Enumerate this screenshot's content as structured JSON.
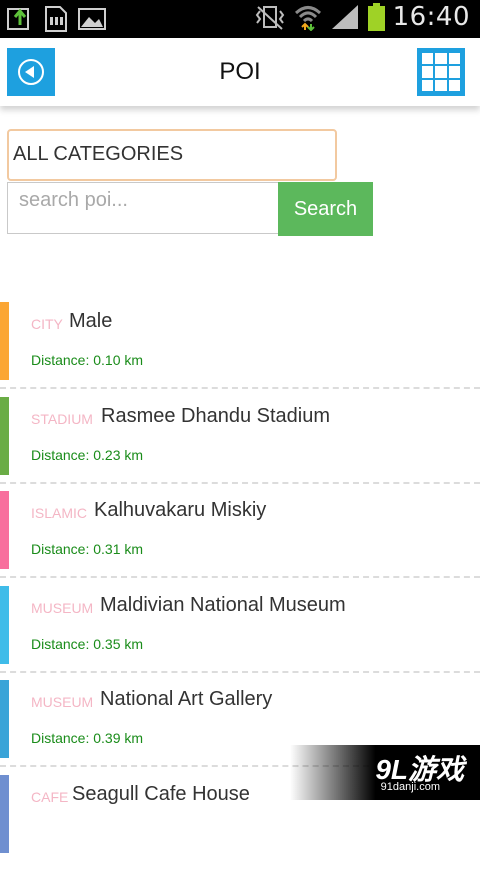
{
  "status_bar": {
    "time": "16:40",
    "icons_left": [
      "upload-icon",
      "sd-card-icon",
      "image-icon"
    ],
    "icons_right": [
      "vibrate-icon",
      "wifi-icon",
      "signal-icon",
      "battery-icon"
    ],
    "battery_color": "#9fd226"
  },
  "app_bar": {
    "title": "POI",
    "accent_color": "#1ea0df"
  },
  "filters": {
    "category_selected": "ALL CATEGORIES",
    "search_placeholder": "search poi...",
    "search_label": "Search",
    "search_color": "#5cb85c"
  },
  "poi_items": [
    {
      "category": "CITY",
      "name": "Male",
      "distance": "Distance: 0.10 km",
      "color": "#fba634"
    },
    {
      "category": "STADIUM",
      "name": "Rasmee Dhandu Stadium",
      "distance": "Distance: 0.23 km",
      "color": "#6aac45"
    },
    {
      "category": "ISLAMIC",
      "name": "Kalhuvakaru Miskiy",
      "distance": "Distance: 0.31 km",
      "color": "#f86f9d"
    },
    {
      "category": "MUSEUM",
      "name": "Maldivian National Museum",
      "distance": "Distance: 0.35 km",
      "color": "#3fbce9"
    },
    {
      "category": "MUSEUM",
      "name": "National Art Gallery",
      "distance": "Distance: 0.39 km",
      "color": "#3aa4d8"
    },
    {
      "category": "CAFE",
      "name": "Seagull Cafe House",
      "distance": "",
      "color": "#6f8fd0"
    }
  ],
  "watermark": {
    "logo": "9L游戏",
    "url": "91danji.com"
  }
}
